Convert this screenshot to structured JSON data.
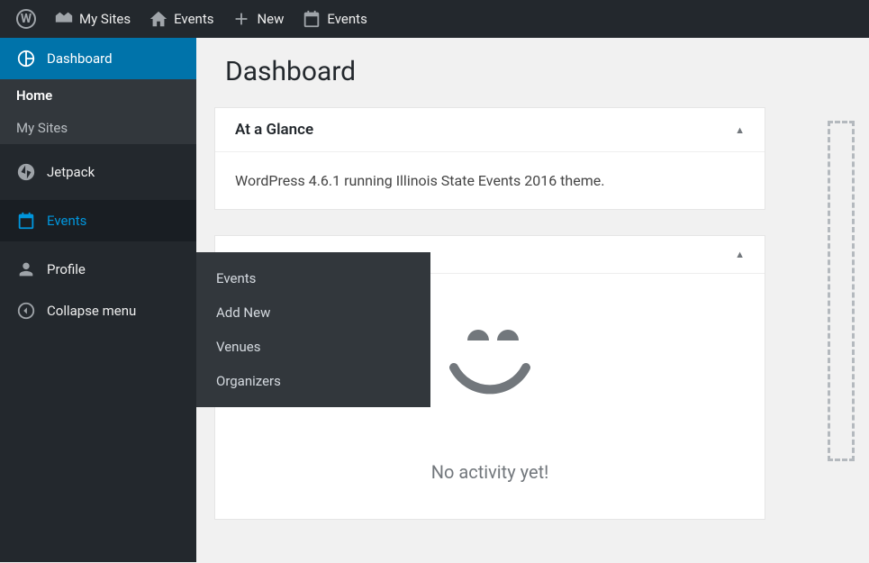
{
  "admin_bar": {
    "my_sites": "My Sites",
    "events_site": "Events",
    "new": "New",
    "events_menu": "Events"
  },
  "sidebar": {
    "dashboard": "Dashboard",
    "home": "Home",
    "my_sites": "My Sites",
    "jetpack": "Jetpack",
    "events": "Events",
    "profile": "Profile",
    "collapse": "Collapse menu"
  },
  "submenu": {
    "items": [
      "Events",
      "Add New",
      "Venues",
      "Organizers"
    ]
  },
  "page": {
    "title": "Dashboard"
  },
  "glance": {
    "title": "At a Glance",
    "body": "WordPress 4.6.1 running Illinois State Events 2016 theme."
  },
  "activity": {
    "empty_text": "No activity yet!"
  }
}
